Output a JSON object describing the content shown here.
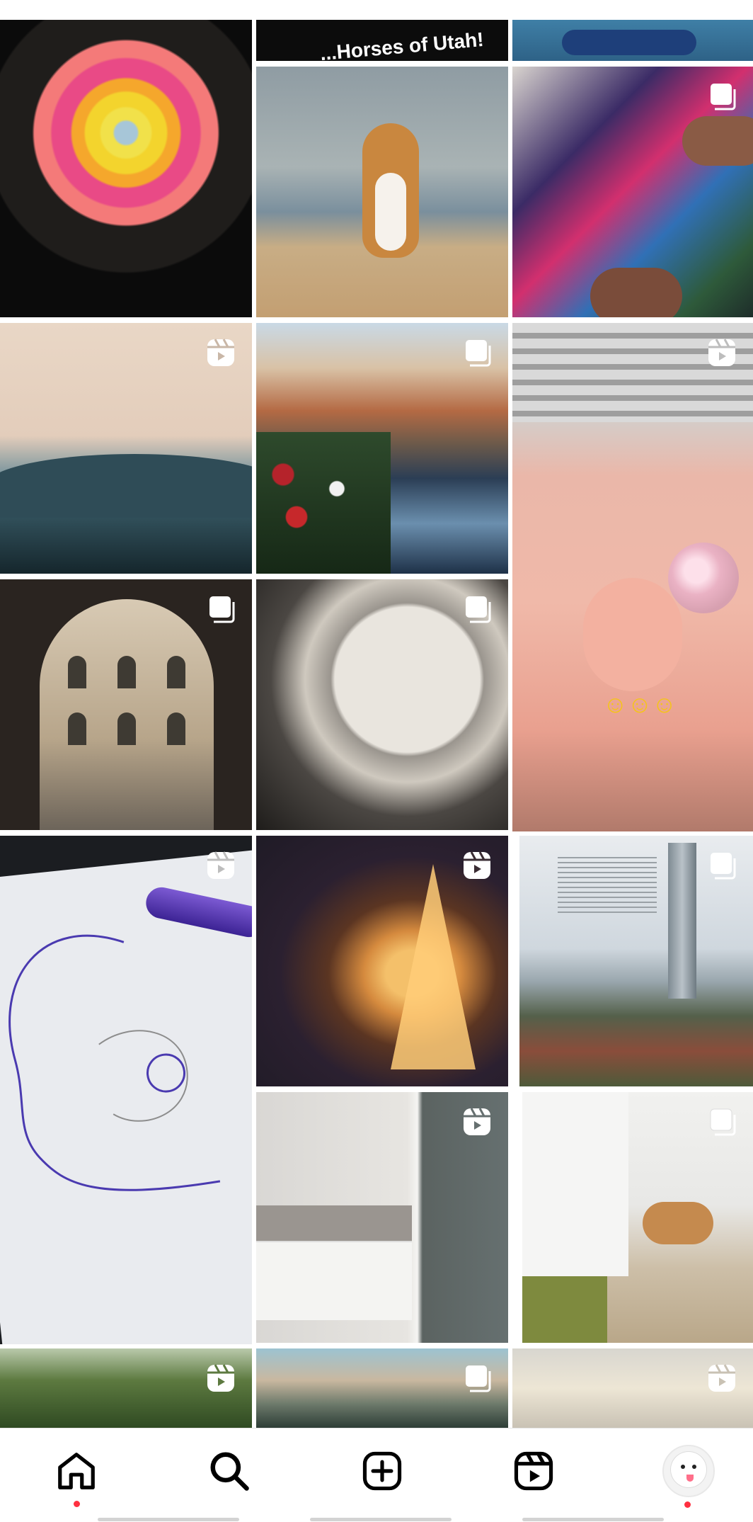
{
  "grid": {
    "tiles": [
      {
        "name": "pancake",
        "badge": ""
      },
      {
        "name": "utah-video",
        "caption": "...Horses of Utah!",
        "badge": ""
      },
      {
        "name": "kayak",
        "badge": ""
      },
      {
        "name": "dog",
        "badge": ""
      },
      {
        "name": "german-shepherds-book",
        "badge": "carousel"
      },
      {
        "name": "mountains",
        "badge": "reel"
      },
      {
        "name": "colmar-canal",
        "badge": "carousel"
      },
      {
        "name": "ornament-craft",
        "badge": "reel",
        "caption": "☺☺☺"
      },
      {
        "name": "arches-courtyard",
        "badge": "carousel"
      },
      {
        "name": "tunnel",
        "badge": "carousel"
      },
      {
        "name": "drawing",
        "badge": "reel"
      },
      {
        "name": "eiffel-fireworks",
        "badge": "reel"
      },
      {
        "name": "skyscraper",
        "badge": "carousel"
      },
      {
        "name": "bathroom",
        "badge": "reel"
      },
      {
        "name": "horse-farm",
        "badge": "carousel"
      },
      {
        "name": "forest",
        "badge": "reel"
      },
      {
        "name": "alps",
        "badge": "carousel"
      },
      {
        "name": "robot",
        "badge": "reel"
      }
    ]
  },
  "nav": {
    "items": [
      {
        "name": "home",
        "icon": "home-icon",
        "active": true,
        "notification_dot": true
      },
      {
        "name": "search",
        "icon": "search-icon",
        "active": false
      },
      {
        "name": "create",
        "icon": "add-post-icon",
        "active": false
      },
      {
        "name": "reels",
        "icon": "reels-icon",
        "active": false
      },
      {
        "name": "profile",
        "icon": "avatar",
        "active": false,
        "notification_dot": true
      }
    ]
  },
  "colors": {
    "background": "#ffffff",
    "icon": "#000000",
    "notification": "#ff3040"
  }
}
